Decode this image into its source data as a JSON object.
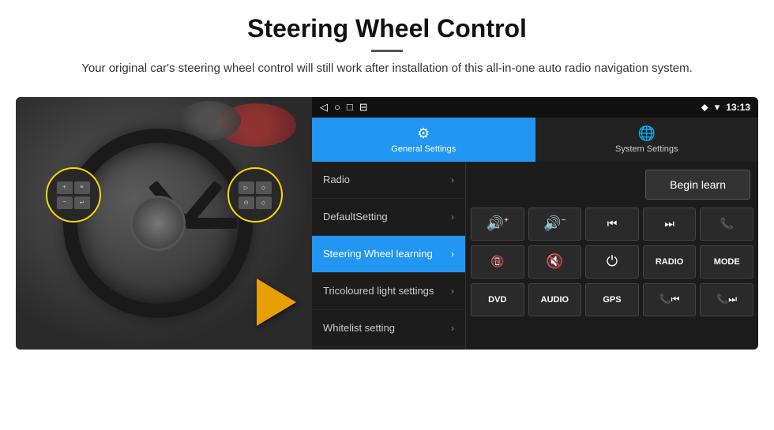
{
  "header": {
    "title": "Steering Wheel Control",
    "subtitle": "Your original car's steering wheel control will still work after installation of this all-in-one auto radio navigation system."
  },
  "status_bar": {
    "time": "13:13",
    "icons": [
      "◁",
      "○",
      "□",
      "⊟"
    ]
  },
  "tabs": [
    {
      "label": "General Settings",
      "icon": "⚙",
      "active": true
    },
    {
      "label": "System Settings",
      "icon": "🌐",
      "active": false
    }
  ],
  "menu": {
    "items": [
      {
        "label": "Radio",
        "active": false
      },
      {
        "label": "DefaultSetting",
        "active": false
      },
      {
        "label": "Steering Wheel learning",
        "active": true
      },
      {
        "label": "Tricoloured light settings",
        "active": false
      },
      {
        "label": "Whitelist setting",
        "active": false
      }
    ]
  },
  "right_panel": {
    "begin_learn_label": "Begin learn",
    "controls_row1": [
      "🔊+",
      "🔊−",
      "⏮",
      "⏭",
      "📞"
    ],
    "controls_row2": [
      "📞",
      "🔇",
      "⏻",
      "RADIO",
      "MODE"
    ],
    "controls_row3_text": [
      "DVD",
      "AUDIO",
      "GPS",
      "",
      ""
    ],
    "controls_row3_icons": [
      "",
      "",
      "",
      "📞⏮",
      "📞⏭"
    ]
  }
}
